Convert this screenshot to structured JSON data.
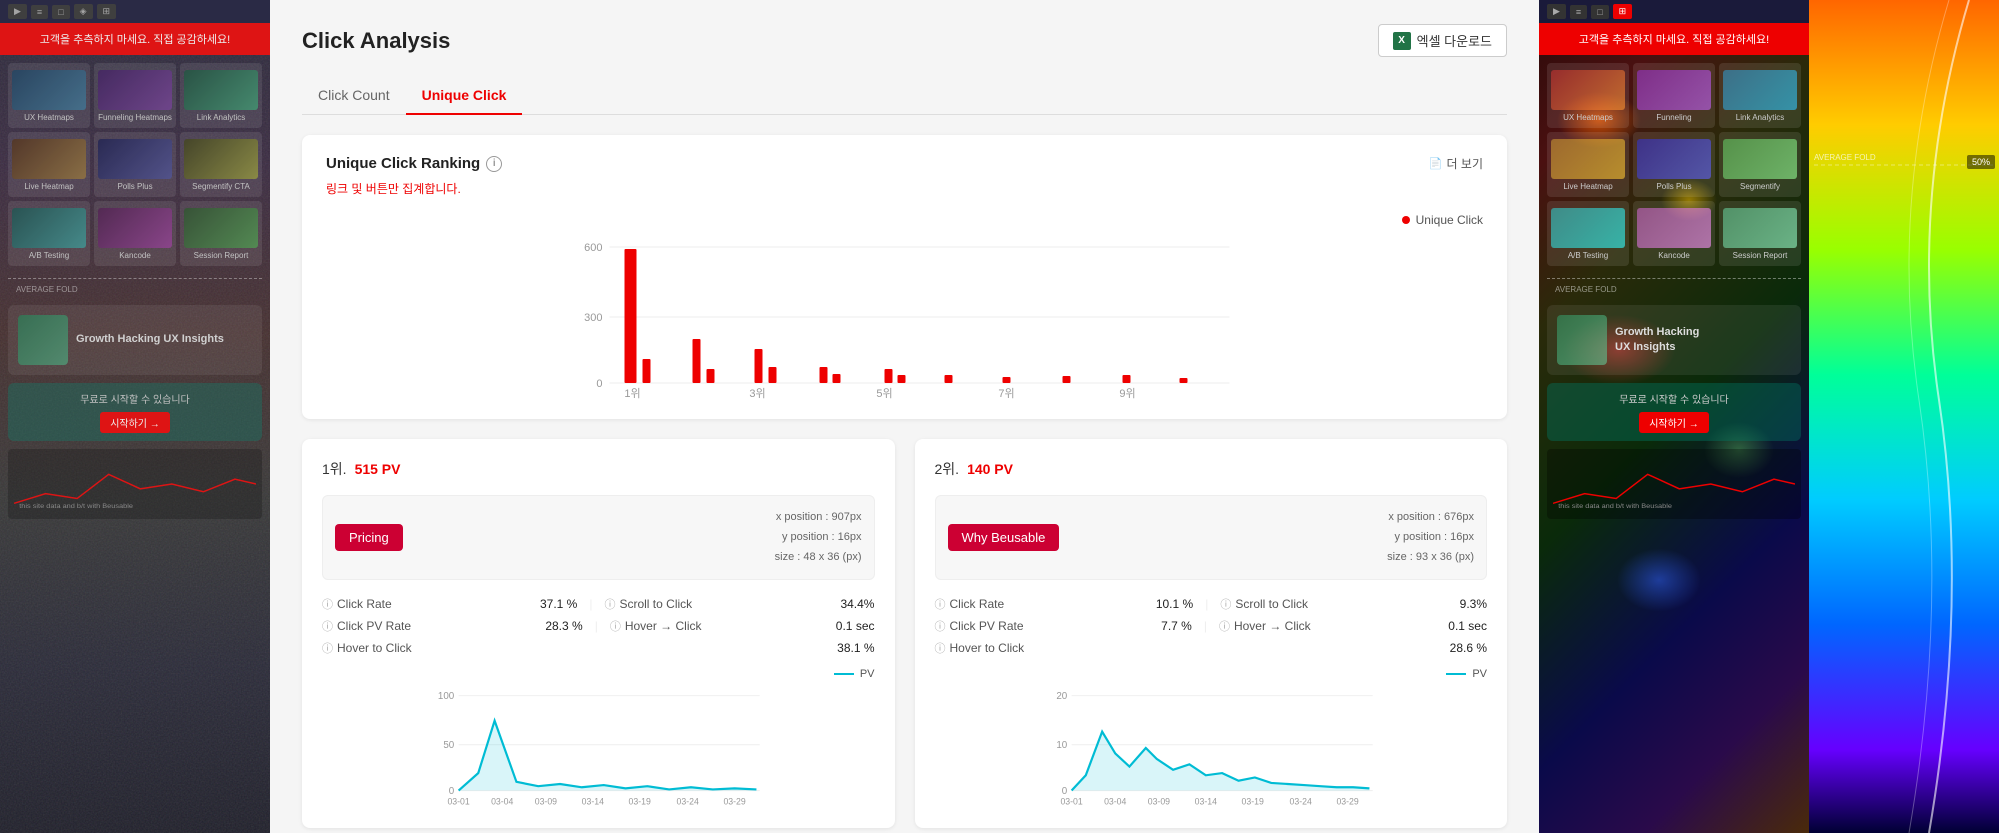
{
  "page": {
    "title": "Click Analysis",
    "excel_btn": "엑셀 다운로드"
  },
  "tabs": [
    {
      "id": "click-count",
      "label": "Click Count",
      "active": false
    },
    {
      "id": "unique-click",
      "label": "Unique Click",
      "active": true
    }
  ],
  "ranking": {
    "title": "Unique Click Ranking",
    "subtitle": "링크 및 버튼만 집계합니다.",
    "more_label": "더 보기",
    "legend_label": "Unique Click",
    "y_labels": [
      "600",
      "300",
      "0"
    ],
    "x_labels": [
      "1위",
      "3위",
      "5위",
      "7위",
      "9위"
    ]
  },
  "detail_cards": [
    {
      "rank": "1위.",
      "pv": "515 PV",
      "btn_label": "Pricing",
      "x_position": "x position : 907px",
      "y_position": "y position : 16px",
      "size": "size : 48 x 36 (px)",
      "stats": [
        {
          "label": "Click Rate",
          "value": "37.1 %",
          "col": 1
        },
        {
          "label": "Scroll to Click",
          "value": "34.4%",
          "col": 2
        },
        {
          "label": "Click PV Rate",
          "value": "28.3 %",
          "col": 1
        },
        {
          "label": "Hover → Click",
          "value": "0.1 sec",
          "col": 2
        },
        {
          "label": "Hover to Click",
          "value": "38.1 %",
          "col": 1
        }
      ],
      "pv_legend": "PV",
      "chart_y_labels": [
        "100",
        "50",
        "0"
      ],
      "chart_x_labels": [
        "03-01",
        "03-04",
        "03-09",
        "03-14",
        "03-19",
        "03-24",
        "03-29"
      ]
    },
    {
      "rank": "2위.",
      "pv": "140 PV",
      "btn_label": "Why Beusable",
      "x_position": "x position : 676px",
      "y_position": "y position : 16px",
      "size": "size : 93 x 36 (px)",
      "stats": [
        {
          "label": "Click Rate",
          "value": "10.1 %",
          "col": 1
        },
        {
          "label": "Scroll to Click",
          "value": "9.3%",
          "col": 2
        },
        {
          "label": "Click PV Rate",
          "value": "7.7 %",
          "col": 1
        },
        {
          "label": "Hover → Click",
          "value": "0.1 sec",
          "col": 2
        },
        {
          "label": "Hover to Click",
          "value": "28.6 %",
          "col": 1
        }
      ],
      "pv_legend": "PV",
      "chart_y_labels": [
        "20",
        "10",
        "0"
      ],
      "chart_x_labels": [
        "03-01",
        "03-04",
        "03-09",
        "03-14",
        "03-19",
        "03-24",
        "03-29"
      ]
    }
  ],
  "side": {
    "notice": "고객을 추측하지 마세요. 직접 공감하세요!",
    "avg_fold_label": "AVERAGE FOLD",
    "cards": [
      {
        "label": "UX Heatmaps"
      },
      {
        "label": "Funneling Heatmaps"
      },
      {
        "label": "Link Analytics"
      },
      {
        "label": "Live Heatmap"
      },
      {
        "label": "Polls Plus"
      },
      {
        "label": "Segmentify CTA"
      },
      {
        "label": "A/B Testing"
      },
      {
        "label": "Kancode"
      },
      {
        "label": "Session Report"
      }
    ],
    "growth_hacking": "Growth Hacking\nUX Insights",
    "bottom_notice": "무료로 시작할 수 있습니다",
    "bottom_btn": "시작하기 →"
  }
}
